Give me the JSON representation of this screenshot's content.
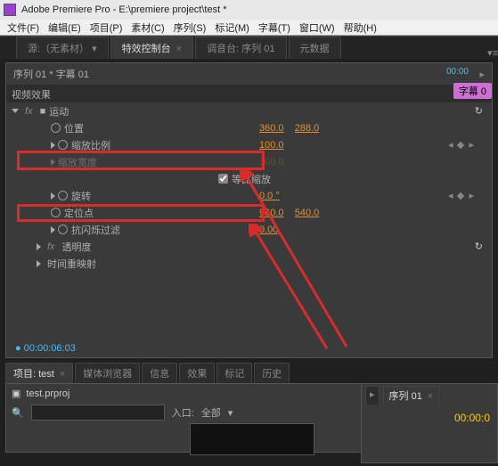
{
  "title": "Adobe Premiere Pro - E:\\premiere project\\test *",
  "menu": {
    "file": "文件(F)",
    "edit": "编辑(E)",
    "project": "项目(P)",
    "clip": "素材(C)",
    "sequence": "序列(S)",
    "marker": "标记(M)",
    "title": "字幕(T)",
    "window": "窗口(W)",
    "help": "帮助(H)"
  },
  "tabs": {
    "source": "源:（无素材）",
    "effectControls": "特效控制台",
    "audioMixer": "调音台: 序列 01",
    "metadata": "元数据"
  },
  "ep": {
    "seqTitle": "序列 01 * 字幕 01",
    "timeHead": "00:00",
    "chip": "字幕 0",
    "videoEffects": "视频效果",
    "motion": "运动",
    "position": "位置",
    "posX": "360.0",
    "posY": "288.0",
    "scale": "缩放比例",
    "scaleVal": "100.0",
    "scaleW": "缩放宽度",
    "scaleWVal": "100.0",
    "uniform": "等比缩放",
    "rotation": "旋转",
    "rotVal": "0.0 °",
    "anchor": "定位点",
    "anchX": "960.0",
    "anchY": "540.0",
    "antiflicker": "抗闪烁过滤",
    "afVal": "0.00",
    "opacity": "透明度",
    "timeremap": "时间重映射",
    "timecode": "00:00:06:03"
  },
  "proj": {
    "tabs": {
      "project": "项目: test",
      "media": "媒体浏览器",
      "info": "信息",
      "effects": "效果",
      "markers": "标记",
      "history": "历史"
    },
    "file": "test.prproj",
    "inpointLabel": "入口:",
    "inpointVal": "全部"
  },
  "right": {
    "tab1": "▸",
    "tab2": "序列 01",
    "tc": "00:00:0"
  }
}
